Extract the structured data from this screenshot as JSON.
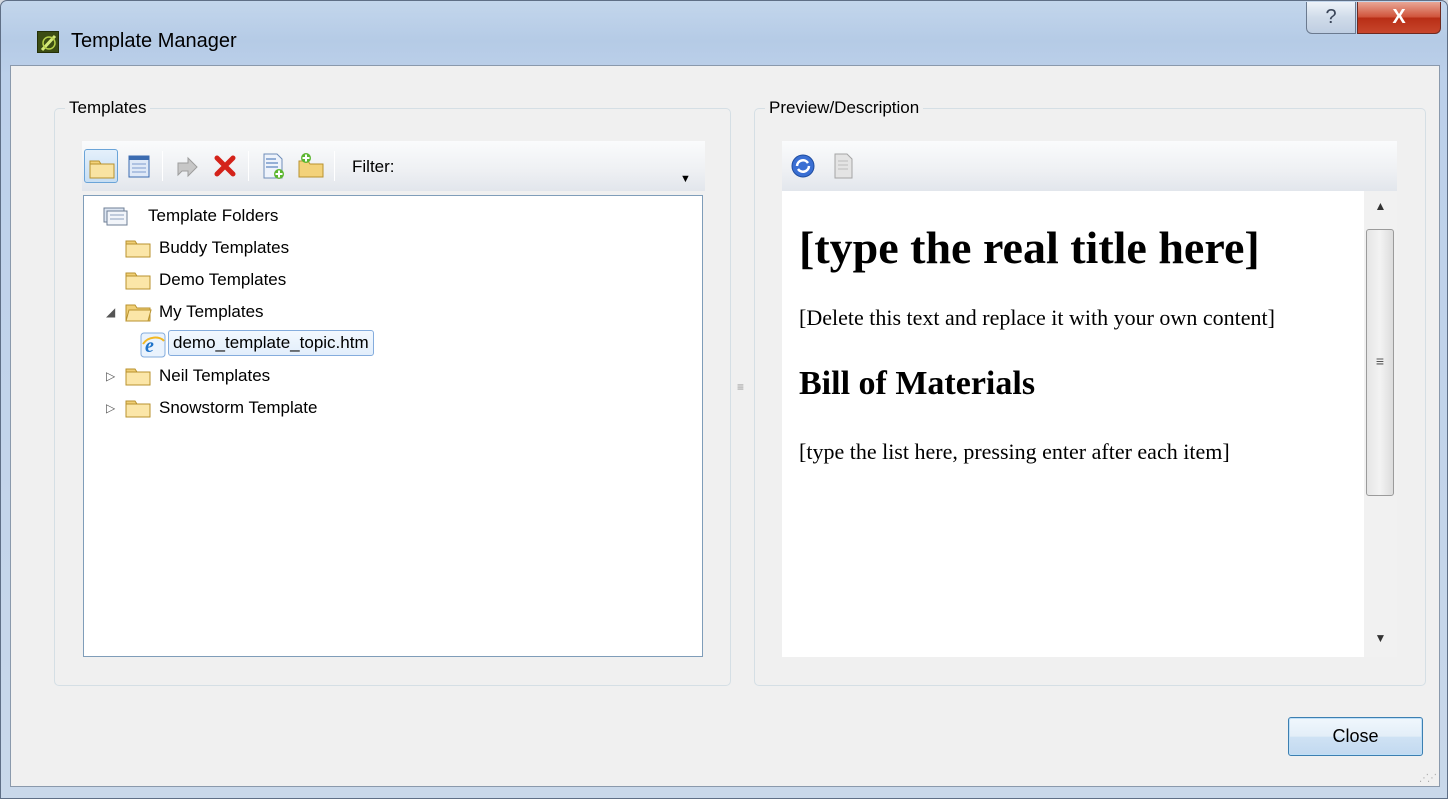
{
  "window": {
    "title": "Template Manager"
  },
  "titlebar": {
    "help_label": "?",
    "close_label": "X"
  },
  "templates_group": {
    "label": "Templates",
    "toolbar": {
      "filter_label": "Filter:",
      "buttons": [
        {
          "icon": "folder-view-icon"
        },
        {
          "icon": "list-view-icon"
        },
        {
          "icon": "export-icon"
        },
        {
          "icon": "delete-icon"
        },
        {
          "icon": "new-template-icon"
        },
        {
          "icon": "new-folder-icon"
        }
      ]
    },
    "tree": {
      "root": "Template Folders",
      "items": [
        {
          "label": "Buddy Templates",
          "expander": ""
        },
        {
          "label": "Demo Templates",
          "expander": ""
        },
        {
          "label": "My Templates",
          "expander": "◢"
        },
        {
          "label": "demo_template_topic.htm",
          "selected": true
        },
        {
          "label": "Neil Templates",
          "expander": "▷"
        },
        {
          "label": "Snowstorm Template",
          "expander": "▷"
        }
      ]
    }
  },
  "preview_group": {
    "label": "Preview/Description",
    "toolbar": {
      "buttons": [
        {
          "icon": "refresh-icon"
        },
        {
          "icon": "edit-document-icon"
        }
      ]
    },
    "content": {
      "heading": "[type the real title here]",
      "paragraph1": "[Delete this text and replace it with your own content]",
      "subheading": "Bill of Materials",
      "paragraph2": "[type the list here, pressing enter after each item]"
    }
  },
  "footer": {
    "close_button": "Close"
  },
  "colors": {
    "accent": "#3c7fb1",
    "titlebar": "#bcd0ea",
    "close_red": "#c8462c"
  }
}
